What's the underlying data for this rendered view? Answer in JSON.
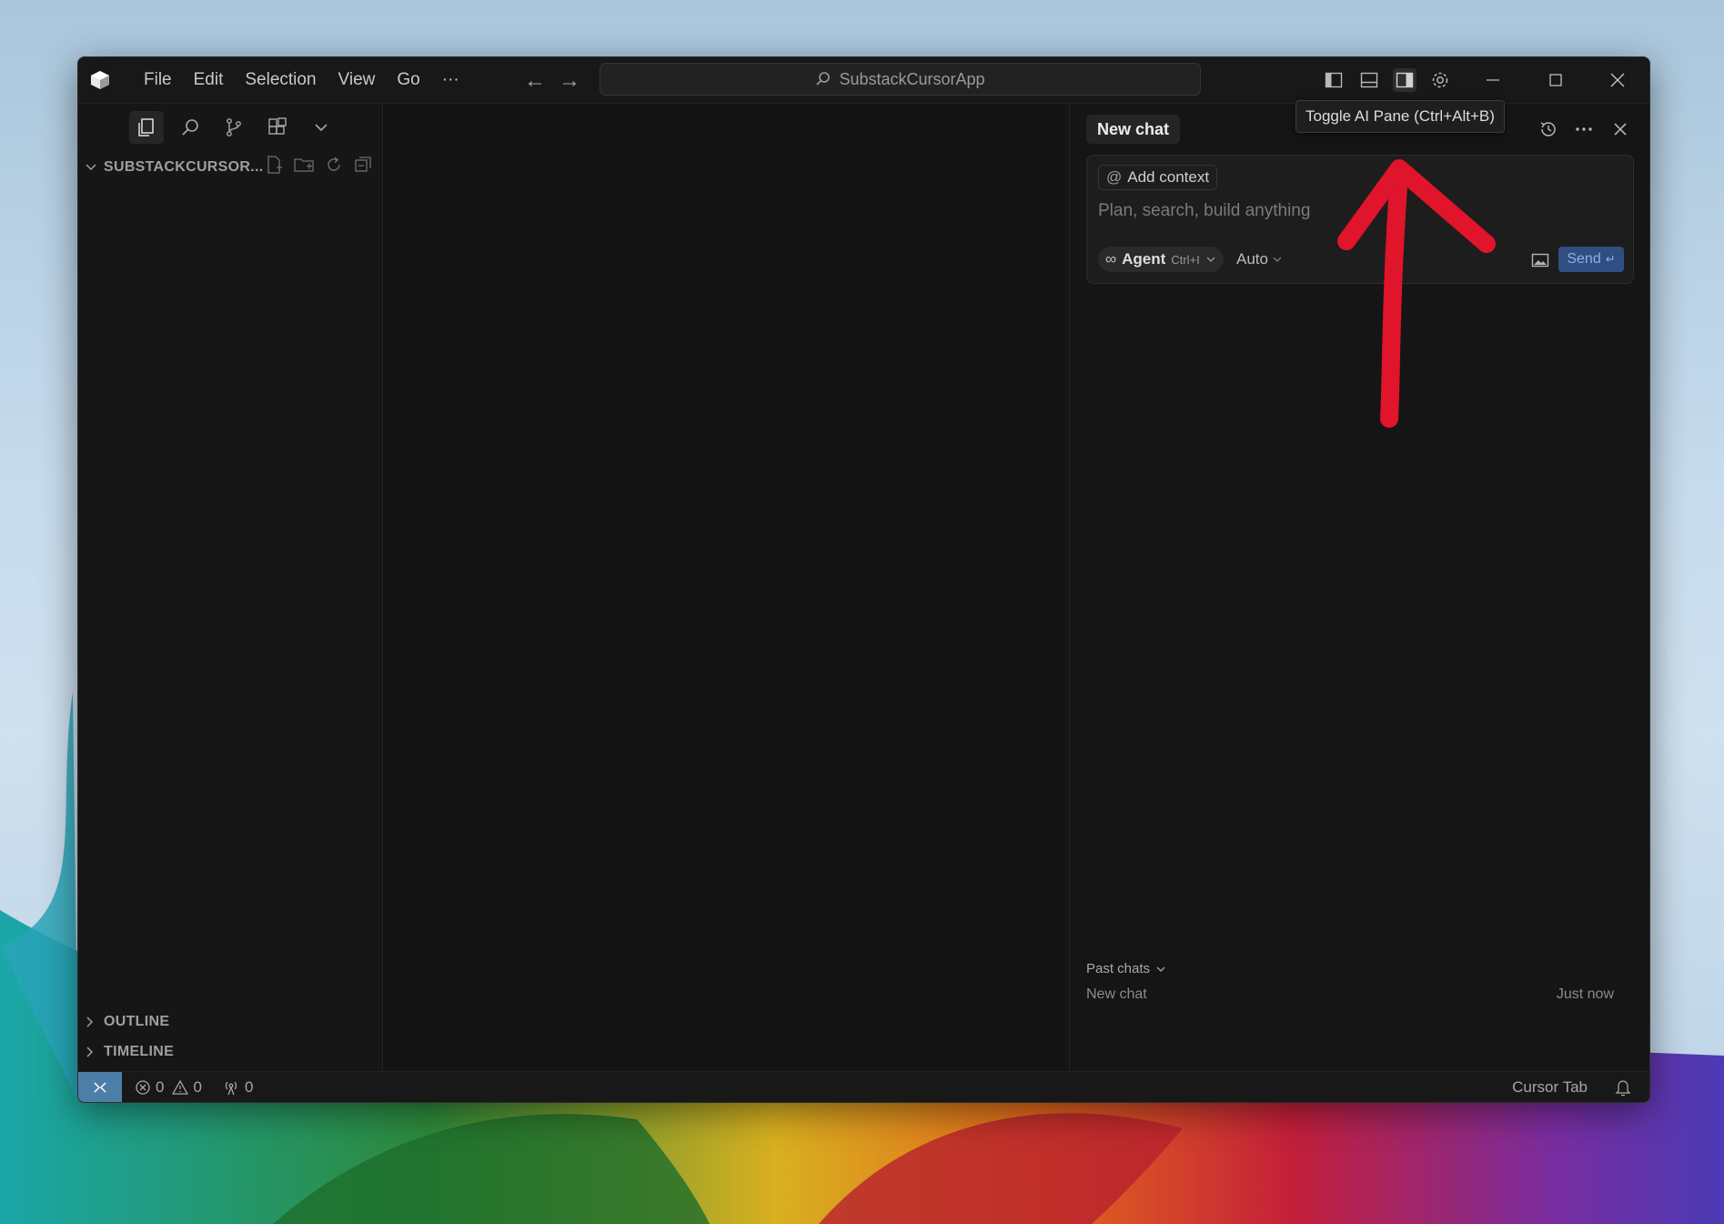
{
  "menu": {
    "items": [
      "File",
      "Edit",
      "Selection",
      "View",
      "Go",
      "···"
    ]
  },
  "search": {
    "label": "SubstackCursorApp"
  },
  "tooltip": {
    "text": "Toggle AI Pane (Ctrl+Alt+B)"
  },
  "explorer": {
    "title": "SUBSTACKCURSOR...",
    "sections": [
      "OUTLINE",
      "TIMELINE"
    ]
  },
  "chat": {
    "tab_label": "New chat",
    "add_context": "Add context",
    "placeholder": "Plan, search, build anything",
    "mode_label": "Agent",
    "mode_shortcut": "Ctrl+I",
    "model_label": "Auto",
    "send_label": "Send",
    "past_chats_label": "Past chats",
    "past": [
      {
        "title": "New chat",
        "time": "Just now"
      }
    ]
  },
  "status": {
    "errors": "0",
    "warnings": "0",
    "ports": "0",
    "cursor_tab": "Cursor Tab"
  },
  "icons": {
    "activity": [
      "files-icon",
      "search-icon",
      "source-control-icon",
      "extensions-icon",
      "chevron-down-icon"
    ],
    "layout": [
      "toggle-primary-sidebar-icon",
      "toggle-panel-icon",
      "toggle-ai-pane-icon",
      "settings-gear-icon"
    ]
  },
  "colors": {
    "window_bg": "#141414",
    "accent_send": "#2f4f82",
    "remote_indicator": "#4d7ea8",
    "annotation_arrow": "#e0142a"
  }
}
